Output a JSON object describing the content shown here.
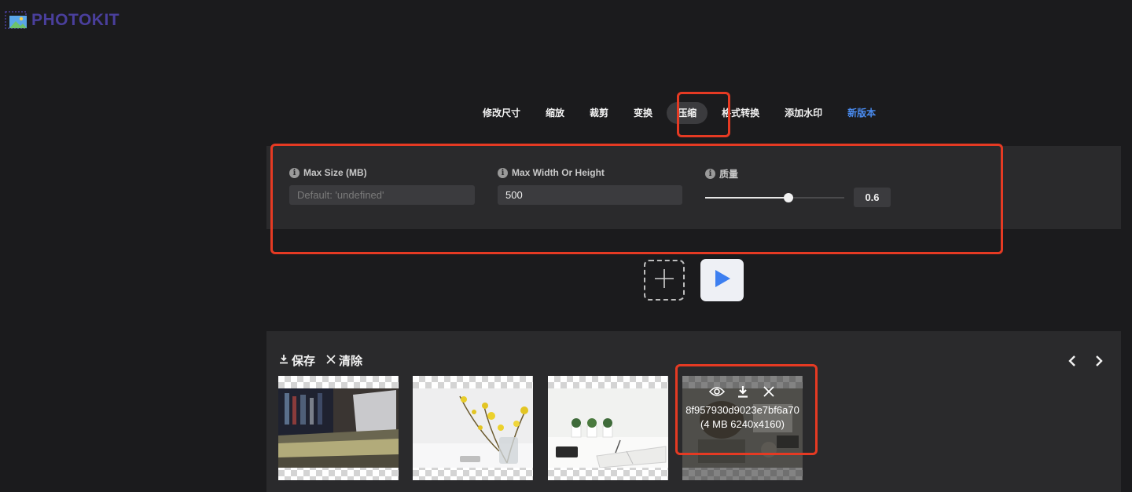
{
  "app": {
    "logo_text": "PHOTOKIT",
    "logo_icon": "image-icon"
  },
  "colors": {
    "background": "#1b1b1d",
    "panel": "#2a2a2c",
    "highlight": "#e53a23",
    "accent": "#4a8cf0",
    "logo": "#4a3f9c"
  },
  "tabs": [
    {
      "label": "修改尺寸"
    },
    {
      "label": "缩放"
    },
    {
      "label": "裁剪"
    },
    {
      "label": "变换"
    },
    {
      "label": "压缩",
      "active": true
    },
    {
      "label": "格式转换"
    },
    {
      "label": "添加水印"
    },
    {
      "label": "新版本",
      "accent": true
    }
  ],
  "settings": {
    "max_size": {
      "label": "Max Size (MB)",
      "placeholder": "Default: 'undefined'",
      "value": ""
    },
    "max_dimension": {
      "label": "Max Width Or Height",
      "value": "500"
    },
    "quality": {
      "label": "质量",
      "value": "0.6",
      "fraction": 0.6
    }
  },
  "controls": {
    "add_icon": "plus-icon",
    "run_icon": "play-icon"
  },
  "gallery": {
    "save_label": "保存",
    "clear_label": "清除",
    "thumbnails": [
      {
        "photo": "laptop-desk"
      },
      {
        "photo": "yellow-flowers"
      },
      {
        "photo": "desk-plants"
      },
      {
        "photo": "desk-overhead",
        "hovered": true,
        "name": "8f957930d9023e7bf6a70",
        "meta": "(4 MB 6240x4160)"
      }
    ]
  }
}
